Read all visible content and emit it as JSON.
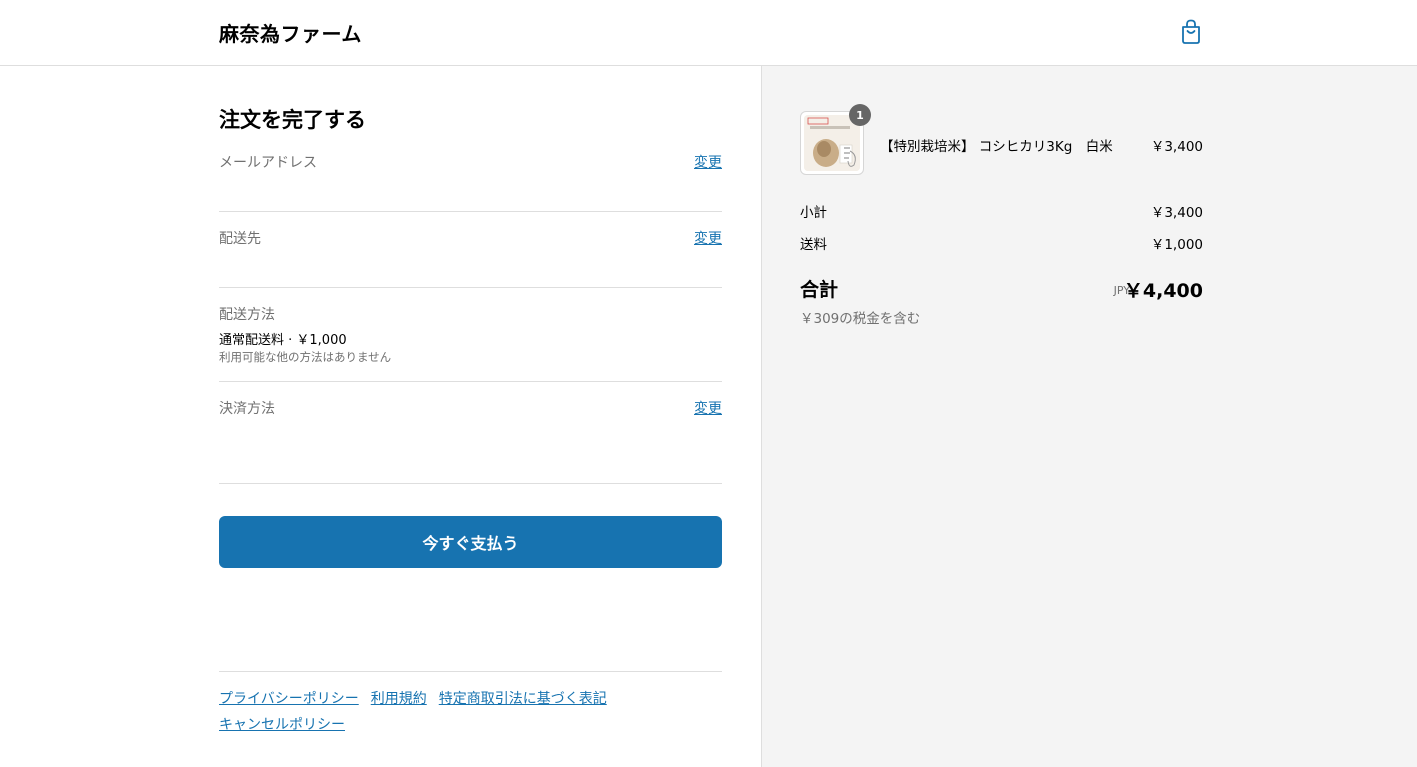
{
  "header": {
    "shop_name": "麻奈為ファーム",
    "cart_icon": "shopping-bag-icon",
    "accent_color": "#1773b0"
  },
  "checkout": {
    "title": "注文を完了する",
    "email": {
      "label": "メールアドレス",
      "change_label": "変更"
    },
    "shipping_address": {
      "label": "配送先",
      "change_label": "変更"
    },
    "shipping_method": {
      "label": "配送方法",
      "value": "通常配送料 · ￥1,000",
      "note": "利用可能な他の方法はありません"
    },
    "payment_method": {
      "label": "決済方法",
      "change_label": "変更"
    },
    "pay_button_label": "今すぐ支払う"
  },
  "footer": {
    "links": [
      "プライバシーポリシー",
      "利用規約",
      "特定商取引法に基づく表記",
      "キャンセルポリシー"
    ]
  },
  "summary": {
    "item": {
      "quantity": "1",
      "name": "【特別栽培米】 コシヒカリ3Kg　白米",
      "price": "￥3,400",
      "image_text": "特別栽培米"
    },
    "subtotal_label": "小計",
    "subtotal_value": "￥3,400",
    "shipping_label": "送料",
    "shipping_value": "￥1,000",
    "total_label": "合計",
    "total_currency": "JPY",
    "total_value": "￥4,400",
    "tax_note": "￥309の税金を含む"
  }
}
